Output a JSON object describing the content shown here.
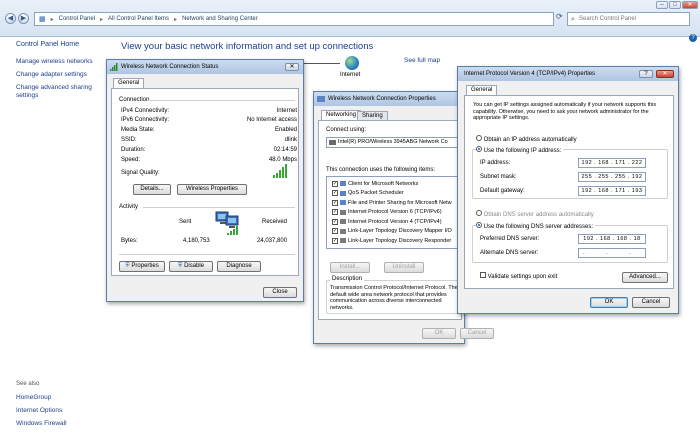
{
  "explorer": {
    "breadcrumbs": [
      "Control Panel",
      "All Control Panel Items",
      "Network and Sharing Center"
    ],
    "search_placeholder": "Search Control Panel",
    "sidebar": {
      "home": "Control Panel Home",
      "tasks": [
        "Manage wireless networks",
        "Change adapter settings",
        "Change advanced sharing settings"
      ],
      "see_also_heading": "See also",
      "see_also": [
        "HomeGroup",
        "Internet Options",
        "Windows Firewall"
      ]
    },
    "page_title": "View your basic network information and set up connections",
    "internet_label": "Internet",
    "full_map_link": "See full map"
  },
  "status_dialog": {
    "title": "Wireless Network Connection Status",
    "tab": "General",
    "connection_heading": "Connection",
    "rows": [
      {
        "label": "IPv4 Connectivity:",
        "value": "Internet"
      },
      {
        "label": "IPv6 Connectivity:",
        "value": "No Internet access"
      },
      {
        "label": "Media State:",
        "value": "Enabled"
      },
      {
        "label": "SSID:",
        "value": "dlink"
      },
      {
        "label": "Duration:",
        "value": "02:14:59"
      },
      {
        "label": "Speed:",
        "value": "48.0 Mbps"
      }
    ],
    "signal_label": "Signal Quality:",
    "signal_level": "5 of 5",
    "details_button": "Details...",
    "wireless_props_button": "Wireless Properties",
    "activity_heading": "Activity",
    "sent_label": "Sent",
    "received_label": "Received",
    "bytes_label": "Bytes:",
    "bytes_sent": "4,180,753",
    "bytes_received": "24,037,800",
    "properties_button": "Properties",
    "disable_button": "Disable",
    "diagnose_button": "Diagnose",
    "close_button": "Close"
  },
  "properties_dialog": {
    "title": "Wireless Network Connection Properties",
    "tabs": [
      "Networking",
      "Sharing"
    ],
    "connect_using_label": "Connect using:",
    "adapter": "Intel(R) PRO/Wireless 3945ABG Network Co",
    "items_label": "This connection uses the following items:",
    "items": [
      "Client for Microsoft Networks",
      "QoS Packet Scheduler",
      "File and Printer Sharing for Microsoft Netw",
      "Internet Protocol Version 6 (TCP/IPv6)",
      "Internet Protocol Version 4 (TCP/IPv4)",
      "Link-Layer Topology Discovery Mapper I/O",
      "Link-Layer Topology Discovery Responder"
    ],
    "install_button": "Install...",
    "uninstall_button": "Uninstall",
    "description_heading": "Description",
    "description": "Transmission Control Protocol/Internet Protocol. The default wide area network protocol that provides communication across diverse interconnected networks.",
    "ok_button": "OK",
    "cancel_button": "Cancel"
  },
  "ipv4_dialog": {
    "title": "Internet Protocol Version 4 (TCP/IPv4) Properties",
    "tab": "General",
    "intro": "You can get IP settings assigned automatically if your network supports this capability. Otherwise, you need to ask your network administrator for the appropriate IP settings.",
    "obtain_ip_auto": "Obtain an IP address automatically",
    "use_ip": "Use the following IP address:",
    "ip_label": "IP address:",
    "ip_value": "192 . 168 . 171 . 222",
    "mask_label": "Subnet mask:",
    "mask_value": "255 . 255 . 255 . 192",
    "gateway_label": "Default gateway:",
    "gateway_value": "192 . 168 . 171 . 193",
    "obtain_dns_auto": "Obtain DNS server address automatically",
    "use_dns": "Use the following DNS server addresses:",
    "preferred_dns_label": "Preferred DNS server:",
    "preferred_dns_value": "192 . 168 . 168 . 18",
    "alternate_dns_label": "Alternate DNS server:",
    "alternate_dns_value": ". . .",
    "validate_label": "Validate settings upon exit",
    "advanced_button": "Advanced...",
    "ok_button": "OK",
    "cancel_button": "Cancel"
  }
}
